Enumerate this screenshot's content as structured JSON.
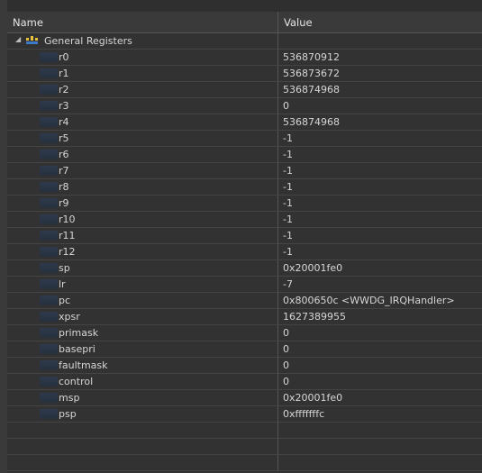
{
  "columns": {
    "name": "Name",
    "value": "Value"
  },
  "group": {
    "label": "General Registers",
    "expander_icon": "expand-arrow-icon",
    "icon": "register-group-icon"
  },
  "registers": [
    {
      "name": "r0",
      "value": "536870912"
    },
    {
      "name": "r1",
      "value": "536873672"
    },
    {
      "name": "r2",
      "value": "536874968"
    },
    {
      "name": "r3",
      "value": "0"
    },
    {
      "name": "r4",
      "value": "536874968"
    },
    {
      "name": "r5",
      "value": "-1"
    },
    {
      "name": "r6",
      "value": "-1"
    },
    {
      "name": "r7",
      "value": "-1"
    },
    {
      "name": "r8",
      "value": "-1"
    },
    {
      "name": "r9",
      "value": "-1"
    },
    {
      "name": "r10",
      "value": "-1"
    },
    {
      "name": "r11",
      "value": "-1"
    },
    {
      "name": "r12",
      "value": "-1"
    },
    {
      "name": "sp",
      "value": "0x20001fe0"
    },
    {
      "name": "lr",
      "value": "-7"
    },
    {
      "name": "pc",
      "value": "0x800650c <WWDG_IRQHandler>"
    },
    {
      "name": "xpsr",
      "value": "1627389955"
    },
    {
      "name": "primask",
      "value": "0"
    },
    {
      "name": "basepri",
      "value": "0"
    },
    {
      "name": "faultmask",
      "value": "0"
    },
    {
      "name": "control",
      "value": "0"
    },
    {
      "name": "msp",
      "value": "0x20001fe0"
    },
    {
      "name": "psp",
      "value": "0xfffffffc"
    }
  ],
  "colors": {
    "background": "#323232",
    "header": "#3a3a3a",
    "grid": "#555555",
    "text": "#d6d6d6"
  }
}
